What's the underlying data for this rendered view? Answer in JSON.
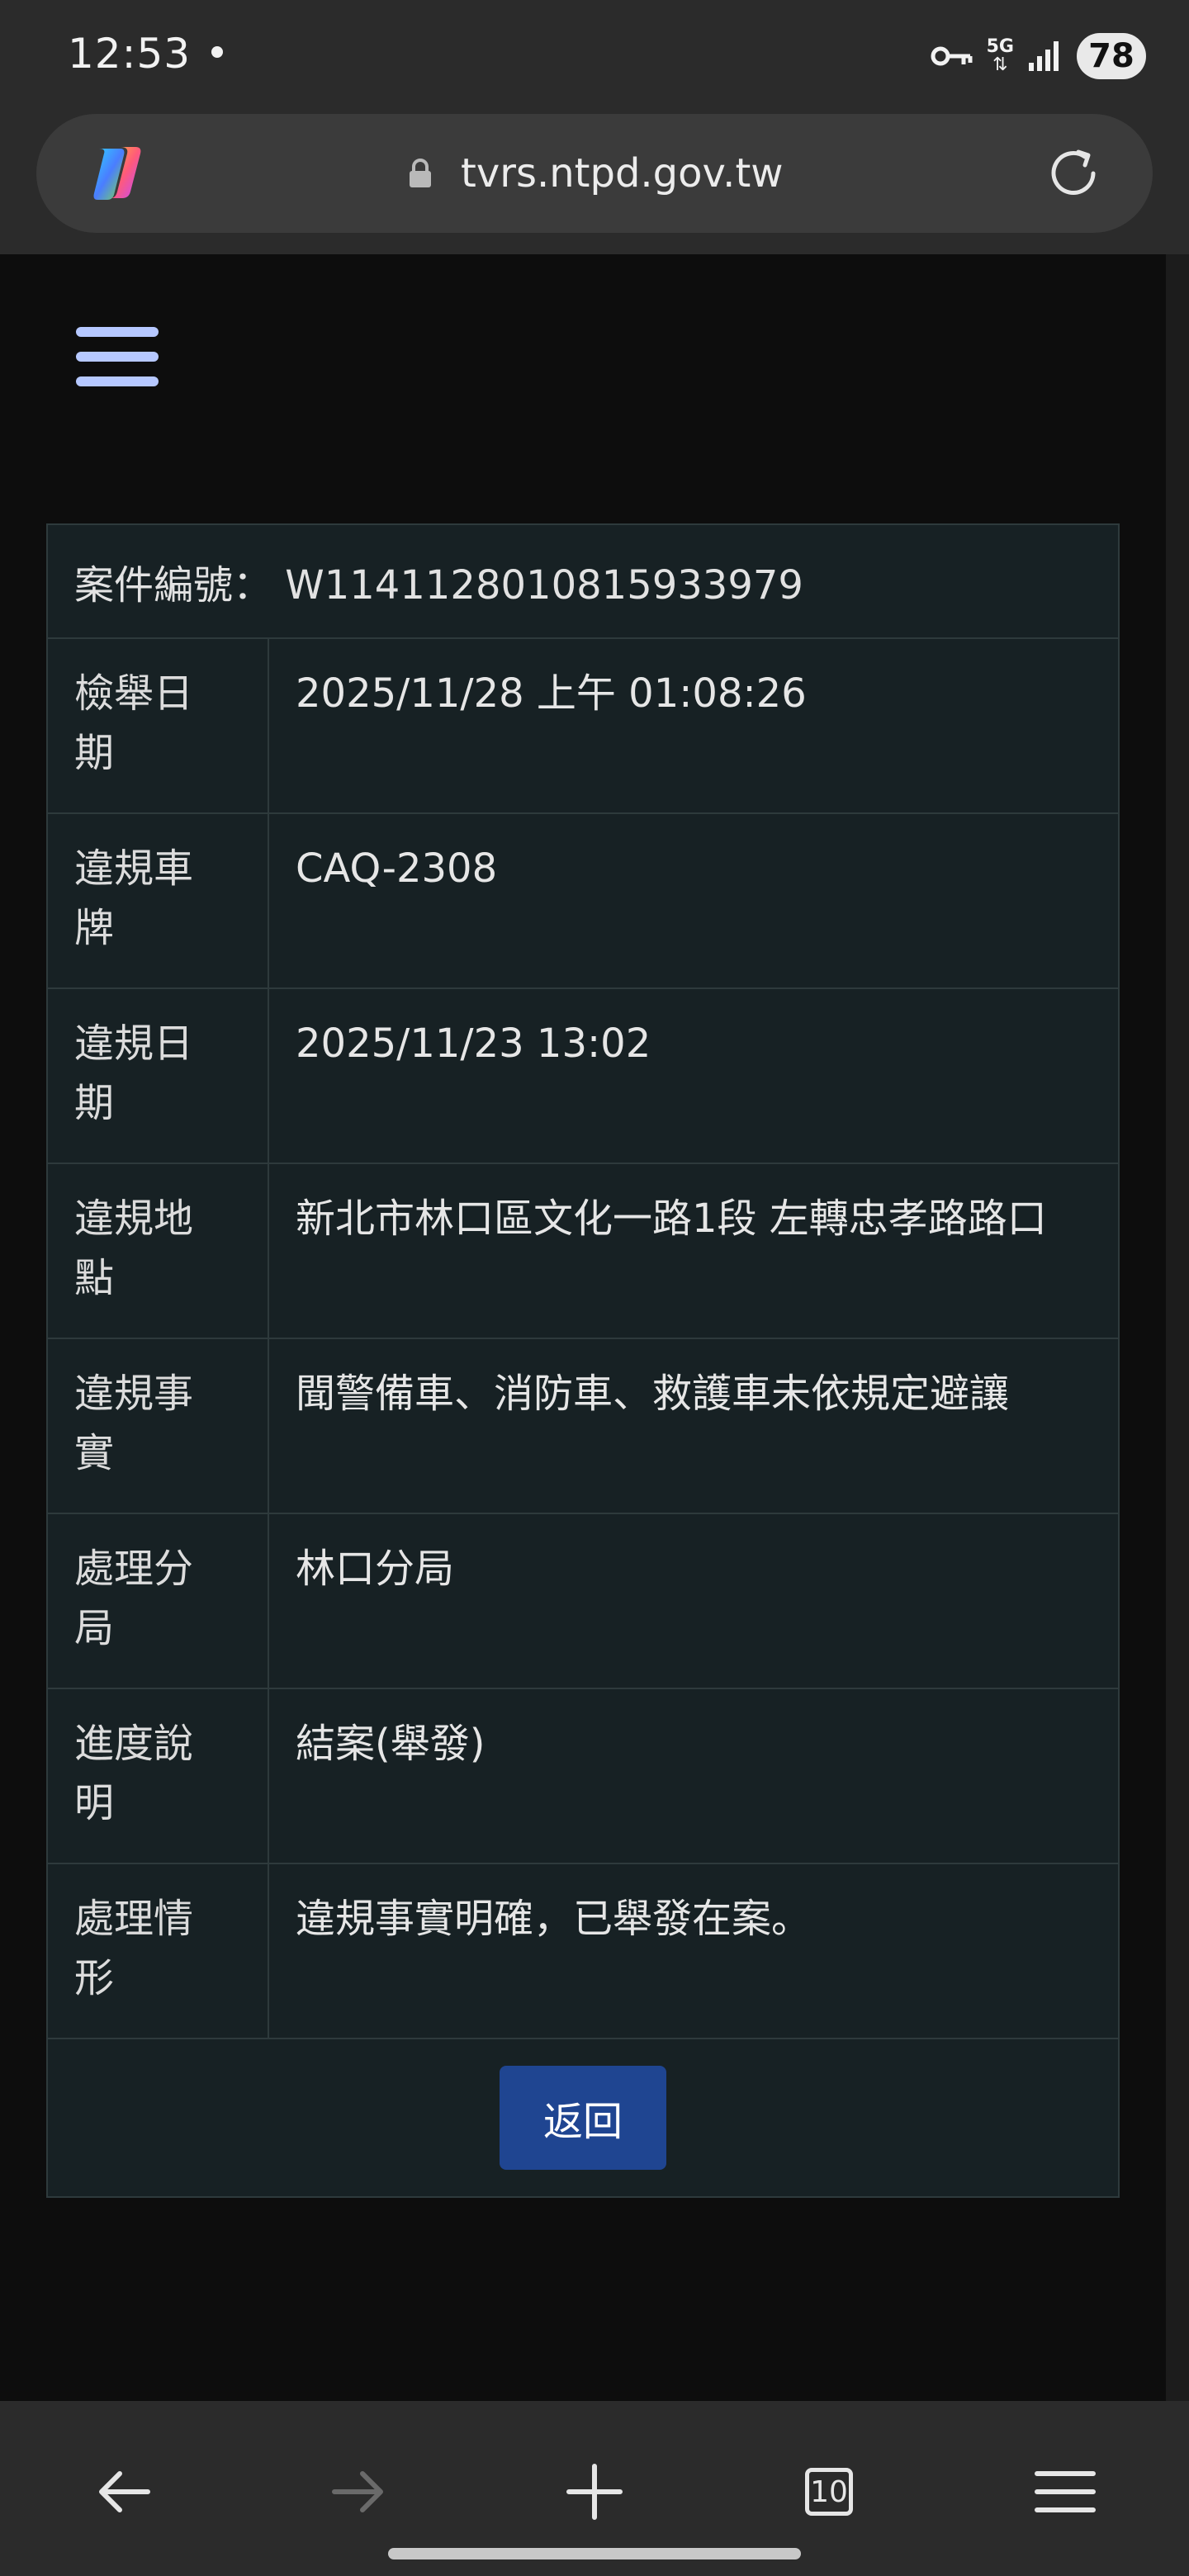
{
  "status_bar": {
    "time": "12:53",
    "network": "5G",
    "battery": "78"
  },
  "browser": {
    "url": "tvrs.ntpd.gov.tw",
    "tab_count": "10",
    "icons": [
      "copilot-icon",
      "lock-icon",
      "reload-icon",
      "back-icon",
      "forward-icon",
      "new-tab-icon",
      "tabs-icon",
      "menu-icon"
    ]
  },
  "page": {
    "case_number": "案件編號： W1141128010815933979",
    "rows": [
      {
        "label_l1": "檢舉日",
        "label_l2": "期",
        "value": "2025/11/28 上午 01:08:26"
      },
      {
        "label_l1": "違規車",
        "label_l2": "牌",
        "value": "CAQ-2308"
      },
      {
        "label_l1": "違規日",
        "label_l2": "期",
        "value": "2025/11/23 13:02"
      },
      {
        "label_l1": "違規地",
        "label_l2": "點",
        "value": "新北市林口區文化一路1段 左轉忠孝路路口"
      },
      {
        "label_l1": "違規事",
        "label_l2": "實",
        "value": "聞警備車、消防車、救護車未依規定避讓"
      },
      {
        "label_l1": "處理分",
        "label_l2": "局",
        "value": "林口分局"
      },
      {
        "label_l1": "進度說",
        "label_l2": "明",
        "value": "結案(舉發)"
      },
      {
        "label_l1": "處理情",
        "label_l2": "形",
        "value": "違規事實明確，已舉發在案。"
      }
    ],
    "back_button": "返回"
  },
  "colors": {
    "accent": "#1f4591",
    "card_bg": "#172124",
    "hamburger": "#b6c8ff"
  }
}
